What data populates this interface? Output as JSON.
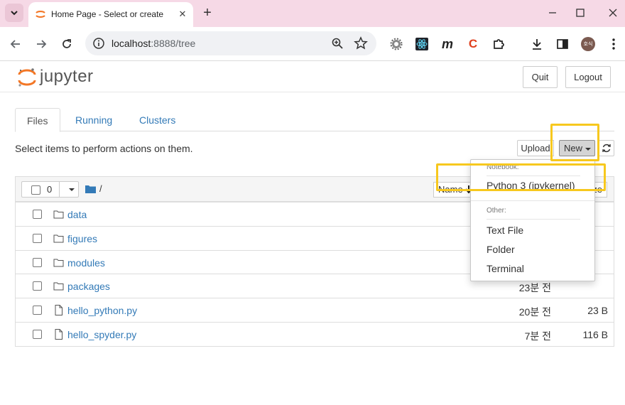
{
  "browser": {
    "tab_title": "Home Page - Select or create a notebook",
    "tab_close": "✕",
    "new_tab": "+",
    "url_host": "localhost",
    "url_path": ":8888/tree",
    "profile_initials": "호식"
  },
  "jupyter": {
    "logo_text": "jupyter",
    "quit_label": "Quit",
    "logout_label": "Logout",
    "tabs": [
      {
        "label": "Files"
      },
      {
        "label": "Running"
      },
      {
        "label": "Clusters"
      }
    ],
    "hint": "Select items to perform actions on them.",
    "upload_label": "Upload",
    "new_label": "New",
    "selected_count": "0",
    "breadcrumb": "/",
    "sort_label": "Name",
    "size_header": "Size"
  },
  "files": [
    {
      "name": "data",
      "type": "folder",
      "modified": "",
      "size": ""
    },
    {
      "name": "figures",
      "type": "folder",
      "modified": "",
      "size": ""
    },
    {
      "name": "modules",
      "type": "folder",
      "modified": "",
      "size": ""
    },
    {
      "name": "packages",
      "type": "folder",
      "modified": "23분 전",
      "size": ""
    },
    {
      "name": "hello_python.py",
      "type": "file",
      "modified": "20분 전",
      "size": "23 B"
    },
    {
      "name": "hello_spyder.py",
      "type": "file",
      "modified": "7분 전",
      "size": "116 B"
    }
  ],
  "new_menu": {
    "notebook_header": "Notebook:",
    "python_kernel": "Python 3 (ipykernel)",
    "other_header": "Other:",
    "text_file": "Text File",
    "folder": "Folder",
    "terminal": "Terminal"
  },
  "colors": {
    "tabstrip": "#f6d9e6",
    "link": "#337ab7",
    "highlight": "#f7c81e",
    "jupyter_orange": "#f37726"
  }
}
